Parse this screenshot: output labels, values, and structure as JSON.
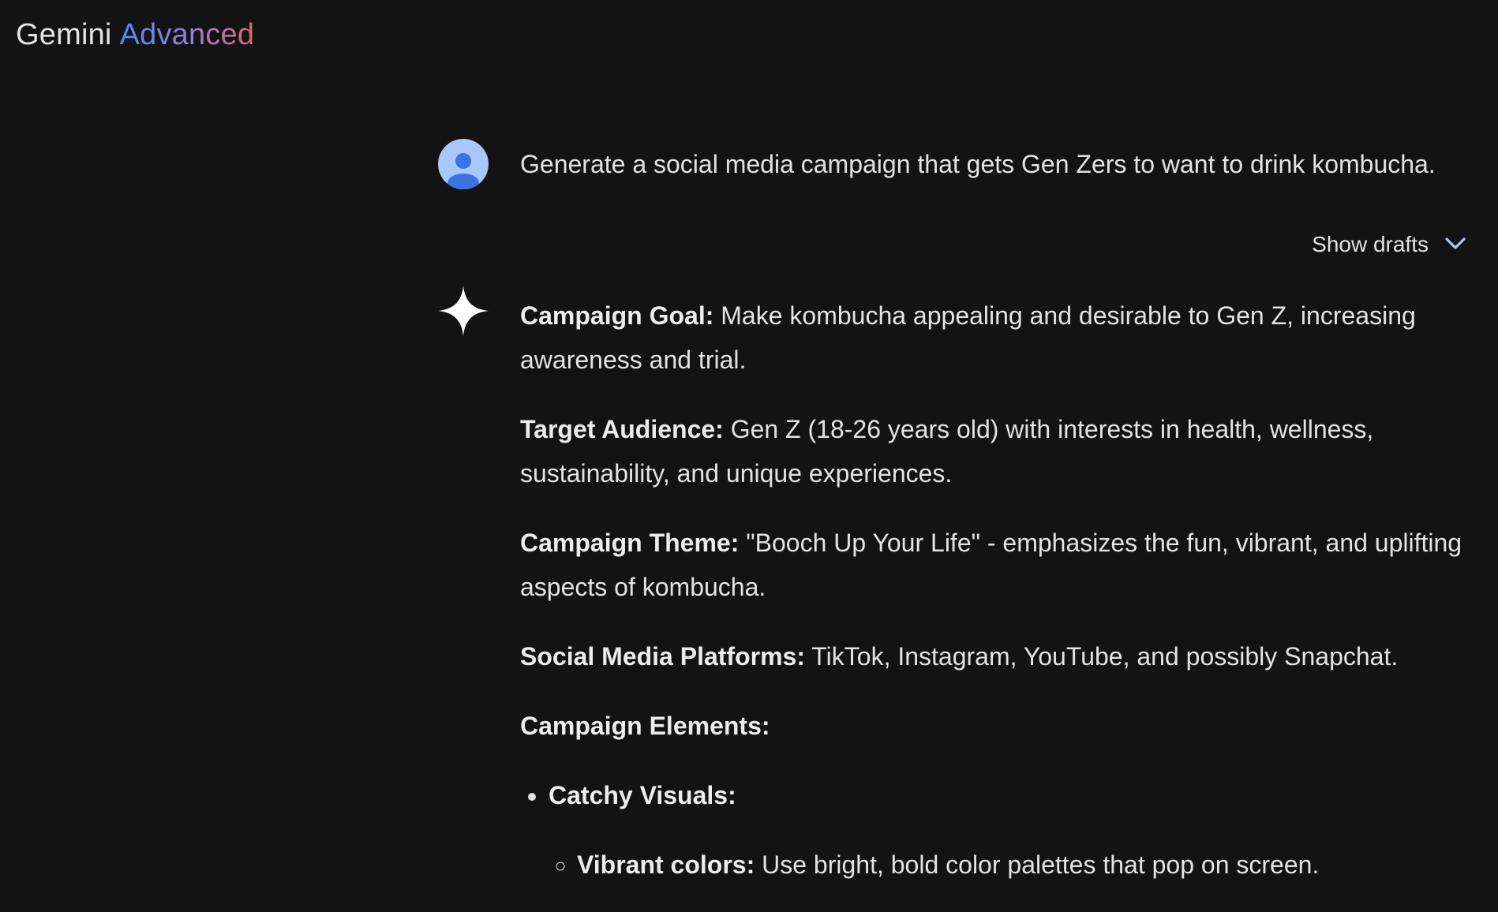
{
  "header": {
    "brand_main": "Gemini",
    "brand_tier": "Advanced"
  },
  "conversation": {
    "user_prompt": "Generate a social media campaign that gets Gen Zers to want to drink kombucha.",
    "show_drafts_label": "Show drafts",
    "response": {
      "goal_label": "Campaign Goal:",
      "goal_text": " Make kombucha appealing and desirable to Gen Z, increasing awareness and trial.",
      "audience_label": "Target Audience:",
      "audience_text": " Gen Z (18-26 years old) with interests in health, wellness, sustainability, and unique experiences.",
      "theme_label": "Campaign Theme:",
      "theme_text": " \"Booch Up Your Life\" - emphasizes the fun, vibrant, and uplifting aspects of kombucha.",
      "platforms_label": "Social Media Platforms:",
      "platforms_text": " TikTok, Instagram, YouTube, and possibly Snapchat.",
      "elements_heading": "Campaign Elements:",
      "bullet_1_label": "Catchy Visuals:",
      "sub_bullet_1_label": "Vibrant colors:",
      "sub_bullet_1_text": " Use bright, bold color palettes that pop on screen."
    }
  },
  "colors": {
    "background": "#131314",
    "text": "#e3e3e3",
    "avatar_light": "#a8c7fa",
    "avatar_dark": "#3b73e0",
    "accent_blue": "#a8c7fa",
    "gradient_start": "#4b8bf4",
    "gradient_end": "#d96570"
  },
  "icons": {
    "avatar": "user-avatar-icon",
    "drafts_toggle": "chevron-down-icon",
    "gemini": "gemini-sparkle-icon"
  }
}
